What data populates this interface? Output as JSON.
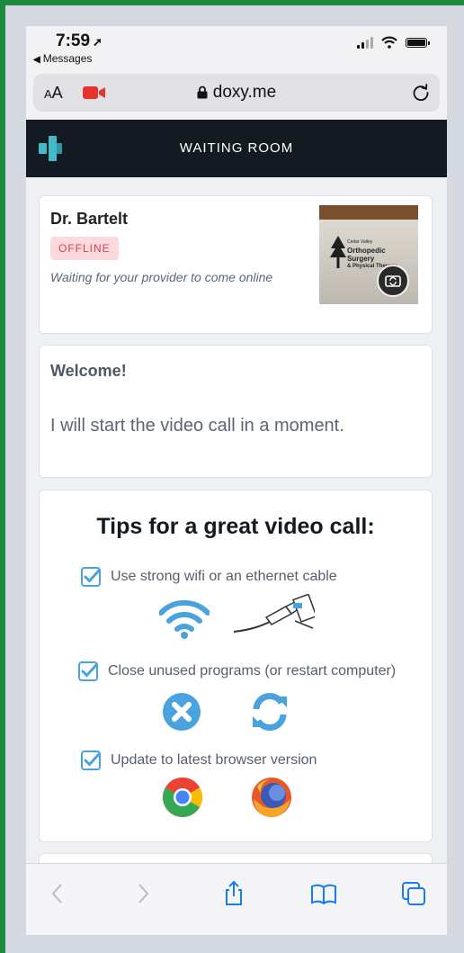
{
  "status_bar": {
    "time": "7:59",
    "back_label": "Messages"
  },
  "browser": {
    "text_size_label": "AA",
    "domain": "doxy.me"
  },
  "app_header": {
    "title": "WAITING ROOM"
  },
  "provider_card": {
    "name": "Dr. Bartelt",
    "status_badge": "OFFLINE",
    "waiting_message": "Waiting for your provider to come online"
  },
  "camera_preview": {
    "sign_small": "Cedar Valley",
    "sign_line1": "Orthopedic",
    "sign_line2": "Surgery",
    "sign_line3": "& Physical Therapy"
  },
  "welcome_card": {
    "heading": "Welcome!",
    "message": "I will start the video call in a moment."
  },
  "tips_card": {
    "heading": "Tips for a great video call:",
    "tips": [
      {
        "label": "Use strong wifi or an ethernet cable",
        "icons": [
          "wifi-icon",
          "ethernet-cable-icon"
        ]
      },
      {
        "label": "Close unused programs (or restart computer)",
        "icons": [
          "close-circle-icon",
          "refresh-icon"
        ]
      },
      {
        "label": "Update to latest browser version",
        "icons": [
          "chrome-icon",
          "firefox-icon"
        ]
      }
    ]
  },
  "colors": {
    "brand": "#43b9c9",
    "header_bg": "#141a22",
    "offline_bg": "#fbd9dc",
    "offline_text": "#d6424e",
    "tip_icon": "#4aa3df"
  }
}
